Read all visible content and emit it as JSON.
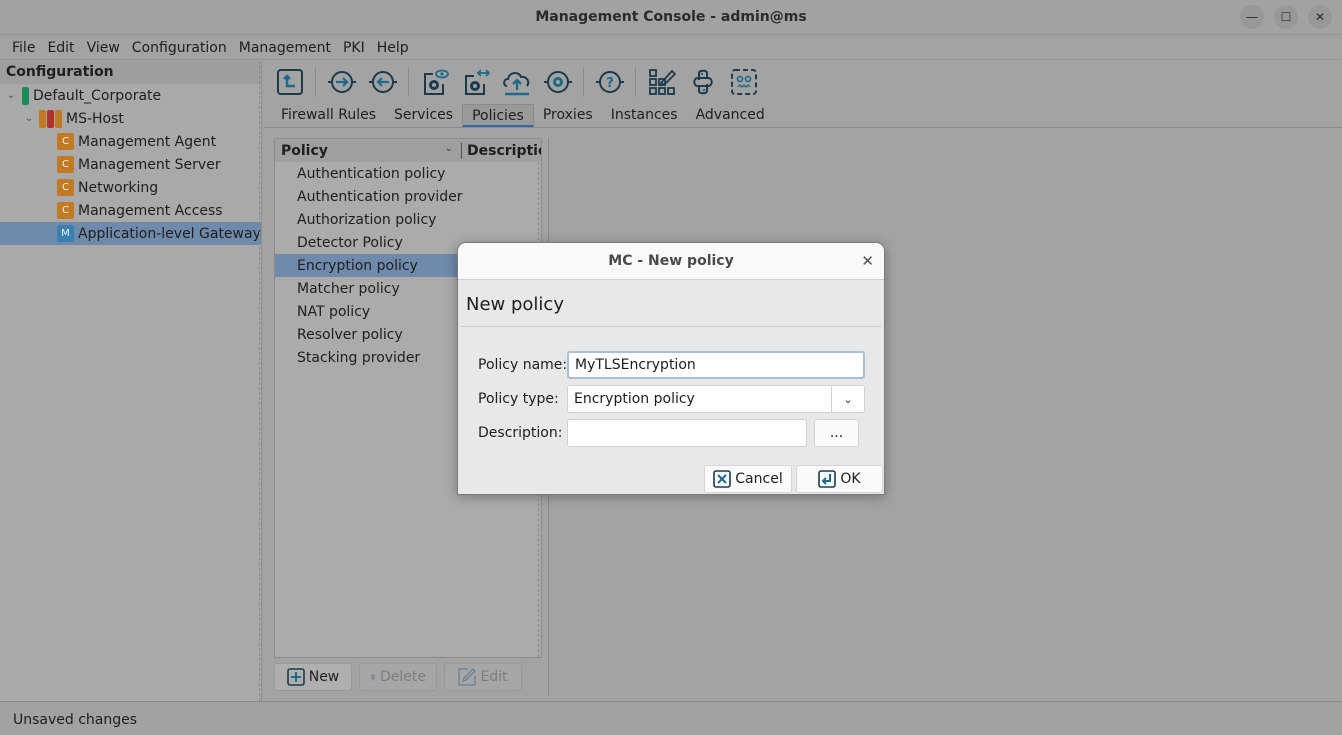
{
  "window": {
    "title": "Management Console - admin@ms",
    "controls": [
      "minimize-icon",
      "maximize-icon",
      "close-icon"
    ]
  },
  "menubar": {
    "items": [
      "File",
      "Edit",
      "View",
      "Configuration",
      "Management",
      "PKI",
      "Help"
    ]
  },
  "left_panel": {
    "header": "Configuration",
    "tree": [
      {
        "label": "Default_Corporate",
        "level": 0,
        "expanded": true,
        "icon": "site-icon"
      },
      {
        "label": "MS-Host",
        "level": 1,
        "expanded": true,
        "icon": "host-icon"
      },
      {
        "label": "Management Agent",
        "level": 2,
        "badge": "C"
      },
      {
        "label": "Management Server",
        "level": 2,
        "badge": "C"
      },
      {
        "label": "Networking",
        "level": 2,
        "badge": "C"
      },
      {
        "label": "Management Access",
        "level": 2,
        "badge": "C"
      },
      {
        "label": "Application-level Gateway",
        "level": 2,
        "badge": "M",
        "selected": true
      }
    ]
  },
  "toolbar": {
    "buttons": [
      "upload-config-icon",
      "connect-icon",
      "disconnect-icon",
      "view-config-icon",
      "compare-config-icon",
      "upload-cloud-icon",
      "settings-circle-icon",
      "help-icon",
      "edit-grid-icon",
      "python-icon",
      "bot-icon"
    ]
  },
  "tabs": {
    "items": [
      "Firewall Rules",
      "Services",
      "Policies",
      "Proxies",
      "Instances",
      "Advanced"
    ],
    "active": "Policies"
  },
  "policy_table": {
    "columns": [
      "Policy",
      "Description"
    ],
    "rows": [
      "Authentication policy",
      "Authentication provider",
      "Authorization policy",
      "Detector Policy",
      "Encryption policy",
      "Matcher policy",
      "NAT policy",
      "Resolver policy",
      "Stacking provider"
    ],
    "selected": "Encryption policy",
    "buttons": {
      "new": "New",
      "delete": "Delete",
      "edit": "Edit"
    }
  },
  "dialog": {
    "title": "MC - New policy",
    "heading": "New policy",
    "fields": {
      "name_label": "Policy name:",
      "name_value": "MyTLSEncryption",
      "type_label": "Policy type:",
      "type_value": "Encryption policy",
      "description_label": "Description:",
      "description_value": "",
      "description_button": "..."
    },
    "buttons": {
      "cancel": "Cancel",
      "ok": "OK"
    }
  },
  "statusbar": {
    "text": "Unsaved changes"
  },
  "colors": {
    "selection": "#6f8aaa",
    "accent": "#3565a8",
    "icon": "#1d3a4a",
    "badge_c": "#c17a23",
    "badge_m": "#3a7fb0",
    "site_green": "#1a8a5a",
    "host_red": "#b0322e"
  }
}
